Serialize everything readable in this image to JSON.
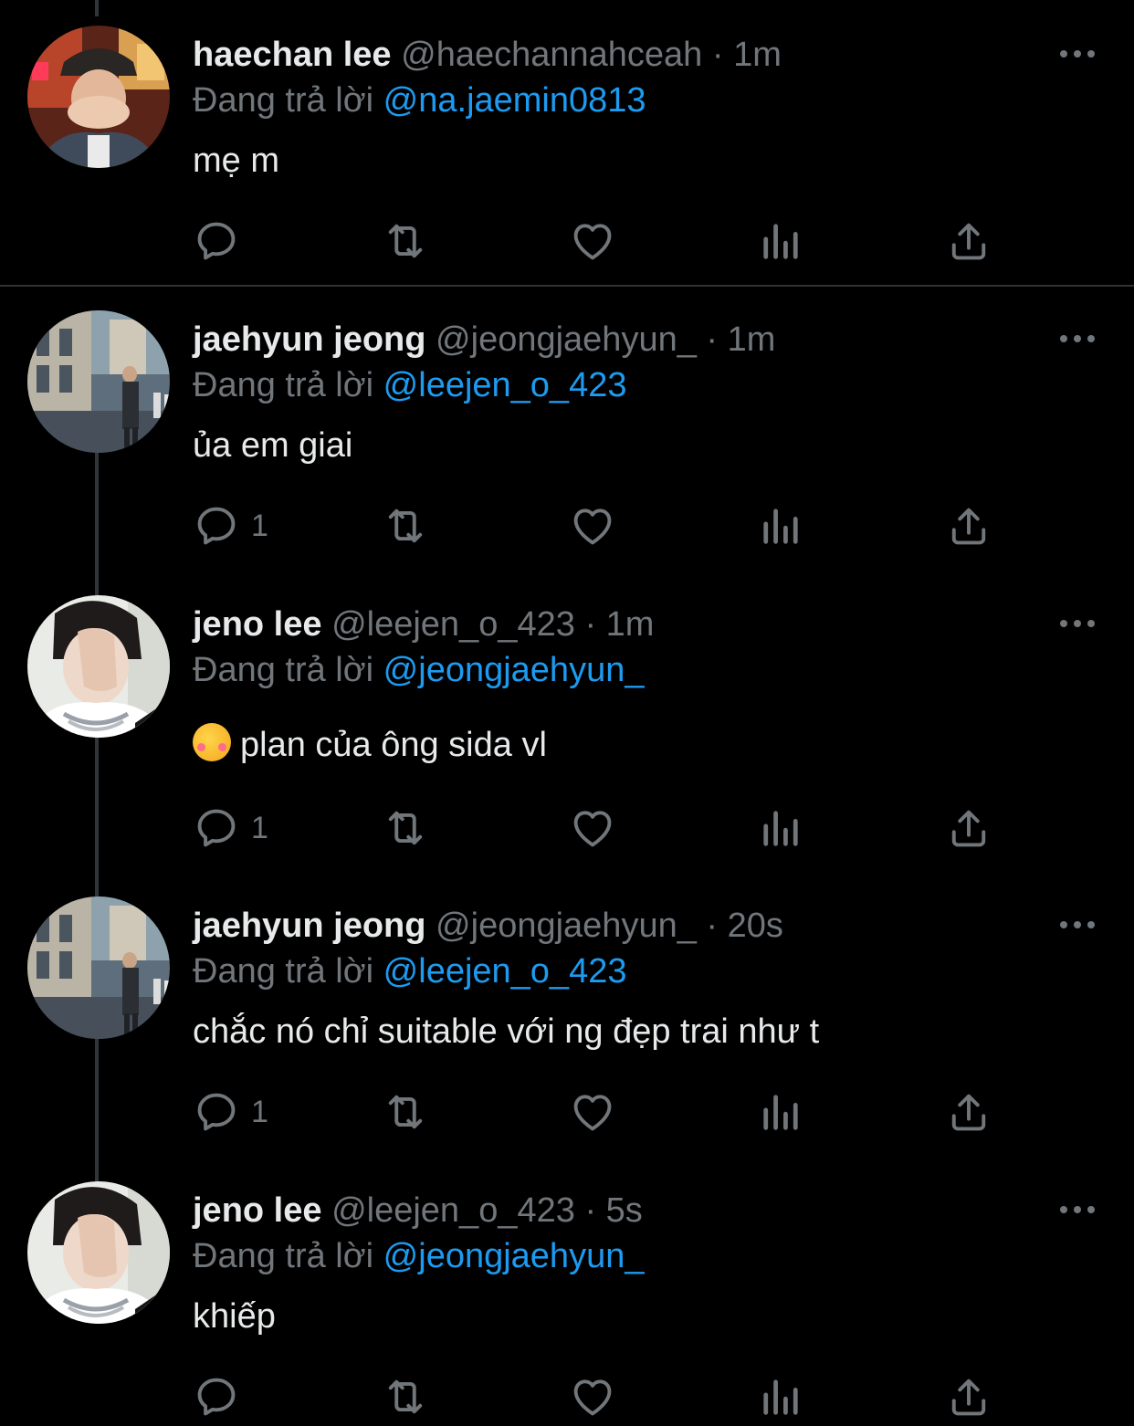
{
  "theme": {
    "background": "#000000",
    "text": "#e7e9ea",
    "muted": "#71767b",
    "link": "#1d9bf0",
    "divider": "#2f3336"
  },
  "replying_prefix": "Đang trả lời",
  "tweets": [
    {
      "name": "haechan lee",
      "handle": "@haechannahceah",
      "separator": "·",
      "time": "1m",
      "reply_to": "@na.jaemin0813",
      "text": "mẹ m",
      "reply_count": "",
      "avatar": "photo-avatar-red-bucket-hat"
    },
    {
      "name": "jaehyun jeong",
      "handle": "@jeongjaehyun_",
      "separator": "·",
      "time": "1m",
      "reply_to": "@leejen_o_423",
      "text": "ủa em giai",
      "reply_count": "1",
      "avatar": "photo-avatar-street"
    },
    {
      "name": "jeno lee",
      "handle": "@leejen_o_423",
      "separator": "·",
      "time": "1m",
      "reply_to": "@jeongjaehyun_",
      "text": "plan của ông sida vl",
      "emoji": "smiling-face-with-hearts-emoji",
      "reply_count": "1",
      "avatar": "photo-avatar-hand-face"
    },
    {
      "name": "jaehyun jeong",
      "handle": "@jeongjaehyun_",
      "separator": "·",
      "time": "20s",
      "reply_to": "@leejen_o_423",
      "text": "chắc nó chỉ suitable với ng đẹp trai như t",
      "reply_count": "1",
      "avatar": "photo-avatar-street"
    },
    {
      "name": "jeno lee",
      "handle": "@leejen_o_423",
      "separator": "·",
      "time": "5s",
      "reply_to": "@jeongjaehyun_",
      "text": "khiếp",
      "reply_count": "",
      "avatar": "photo-avatar-hand-face"
    }
  ],
  "action_icons": [
    "reply-icon",
    "retweet-icon",
    "like-icon",
    "views-icon",
    "share-icon"
  ]
}
